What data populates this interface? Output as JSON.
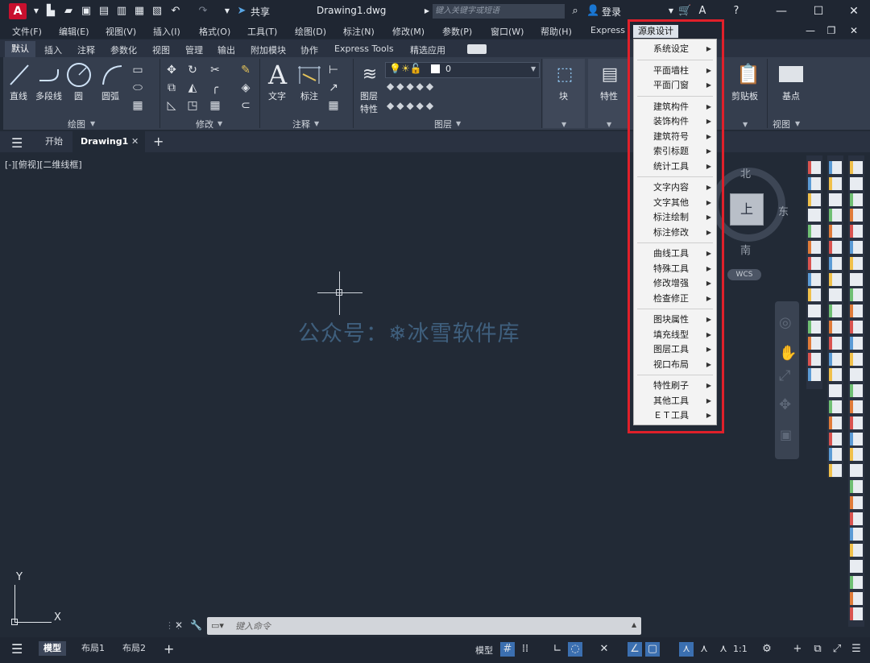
{
  "titlebar": {
    "app_logo": "A",
    "share_label": "共享",
    "document_title": "Drawing1.dwg",
    "search_placeholder": "键入关键字或短语",
    "login_label": "登录"
  },
  "menubar": {
    "items": [
      "文件(F)",
      "编辑(E)",
      "视图(V)",
      "插入(I)",
      "格式(O)",
      "工具(T)",
      "绘图(D)",
      "标注(N)",
      "修改(M)",
      "参数(P)",
      "窗口(W)",
      "帮助(H)",
      "Express",
      "源泉设计"
    ]
  },
  "ribbon_tabs": [
    "默认",
    "插入",
    "注释",
    "参数化",
    "视图",
    "管理",
    "输出",
    "附加模块",
    "协作",
    "Express Tools",
    "精选应用"
  ],
  "ribbon": {
    "draw_panel": {
      "title": "绘图",
      "line": "直线",
      "polyline": "多段线",
      "circle": "圆",
      "arc": "圆弧"
    },
    "modify_panel": {
      "title": "修改"
    },
    "annotation_panel": {
      "title": "注释",
      "text": "文字",
      "dimension": "标注"
    },
    "layers_panel": {
      "title": "图层",
      "layer_props": "图层\n特性",
      "layer_props_1": "图层",
      "layer_props_2": "特性",
      "current_layer": "0"
    },
    "block": "块",
    "properties": "特性",
    "clipboard": "剪贴板",
    "view_panel": {
      "base": "基点",
      "title": "视图"
    }
  },
  "file_tabs": {
    "start": "开始",
    "drawing": "Drawing1"
  },
  "viewport": {
    "label": "[-][俯视][二维线框]",
    "watermark": "公众号：❄冰雪软件库"
  },
  "dropdown": {
    "groups": [
      [
        "系统设定"
      ],
      [
        "平面墙柱",
        "平面门窗"
      ],
      [
        "建筑构件",
        "装饰构件",
        "建筑符号",
        "索引标题",
        "统计工具"
      ],
      [
        "文字内容",
        "文字其他",
        "标注绘制",
        "标注修改"
      ],
      [
        "曲线工具",
        "特殊工具",
        "修改增强",
        "检查修正"
      ],
      [
        "图块属性",
        "填充线型",
        "图层工具",
        "视口布局"
      ],
      [
        "特性刷子",
        "其他工具",
        "ＥＴ工具"
      ]
    ]
  },
  "viewcube": {
    "north": "北",
    "east": "东",
    "south": "南",
    "top": "上",
    "wcs": "WCS"
  },
  "command": {
    "placeholder": "键入命令"
  },
  "ucs": {
    "x": "X",
    "y": "Y"
  },
  "statusbar": {
    "tabs": [
      "模型",
      "布局1",
      "布局2"
    ],
    "model_label": "模型",
    "scale": "1:1"
  },
  "colors": {
    "highlight": "#e0202a",
    "background": "#222a36",
    "logo": "#c8102e"
  }
}
